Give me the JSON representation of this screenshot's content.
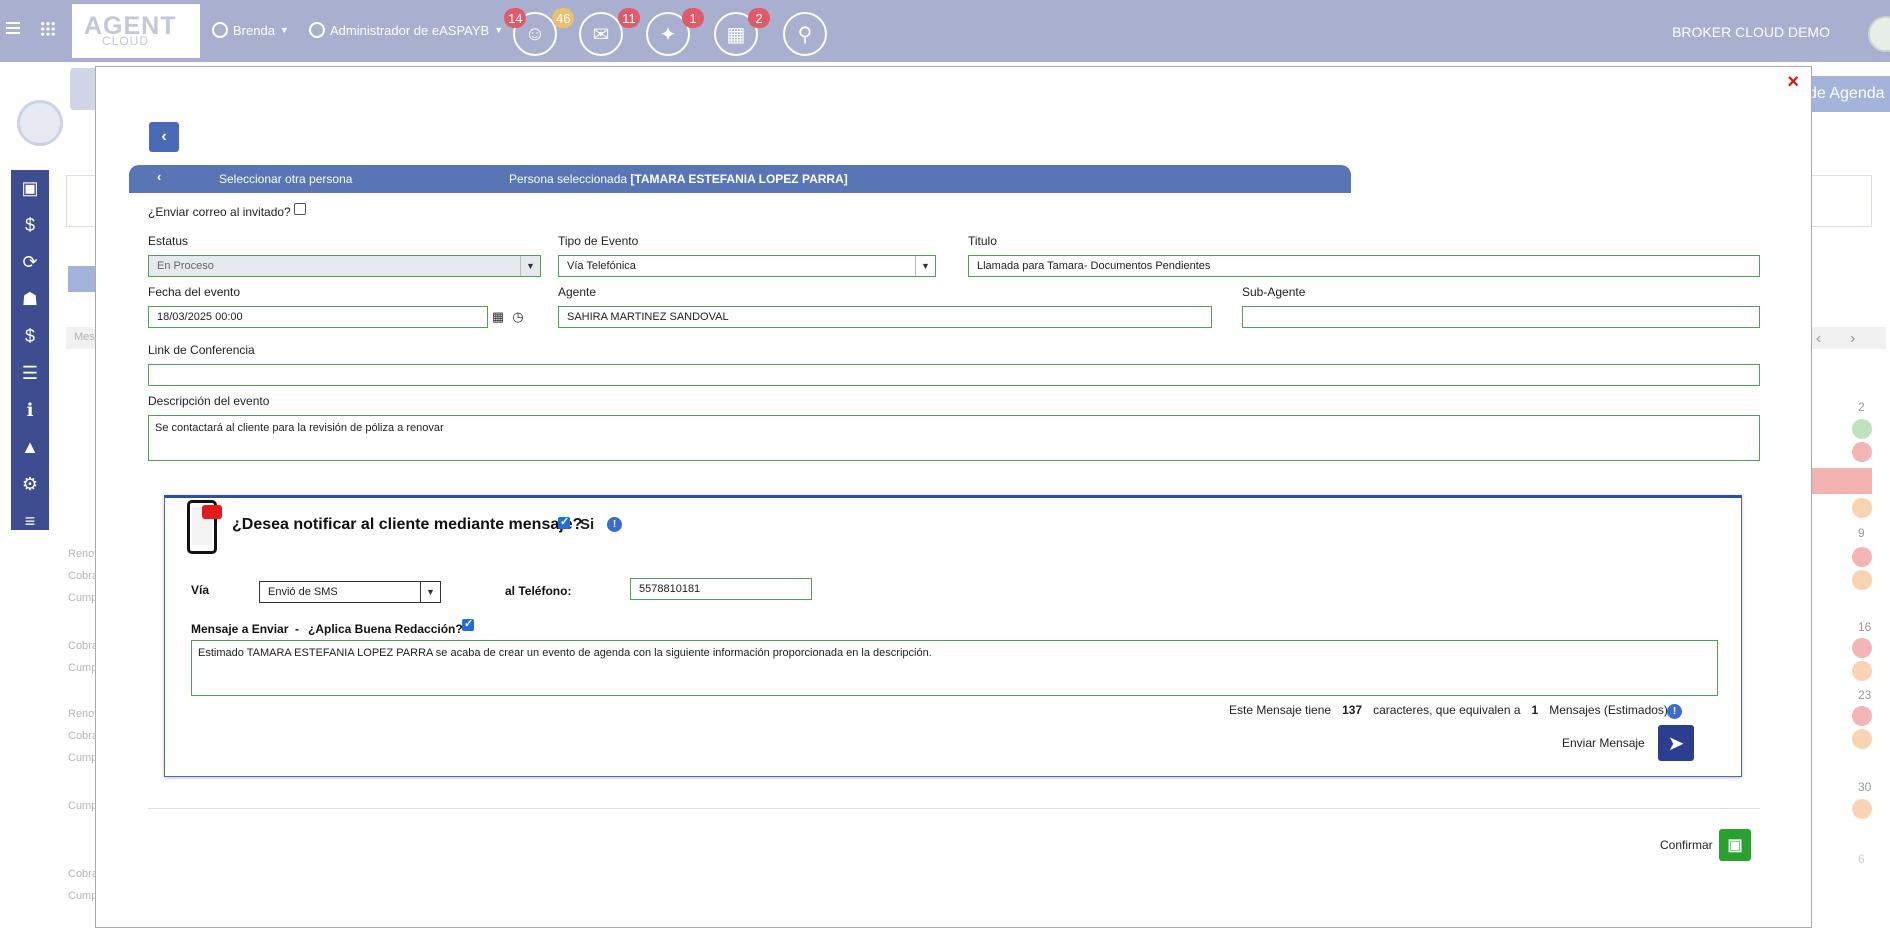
{
  "topbar": {
    "logo_main": "AGENT",
    "logo_sub": "CLOUD",
    "user": "Brenda",
    "role": "Administrador de eASPAYB",
    "badges": {
      "contacts": "14",
      "contacts2": "46",
      "mail": "11",
      "gifts": "1",
      "calendar": "2"
    },
    "company": "BROKER CLOUD DEMO"
  },
  "background": {
    "agenda_button": "de Agenda",
    "toolbar_text": "Mes",
    "labels": [
      "Renov",
      "Cobra",
      "Cump",
      "Cobra",
      "Cump",
      "Renov",
      "Cobra",
      "Cump",
      "Cump",
      "Cobra",
      "Cump"
    ],
    "day_numbers": [
      "2",
      "9",
      "16",
      "23",
      "30",
      "6"
    ]
  },
  "modal": {
    "close": "×",
    "back": "‹",
    "select_other": "Seleccionar otra persona",
    "selected_prefix": "Persona seleccionada",
    "selected_name": "[TAMARA ESTEFANIA LOPEZ PARRA]",
    "send_mail_label": "¿Enviar correo al invitado?",
    "status": {
      "label": "Estatus",
      "value": "En Proceso"
    },
    "event_type": {
      "label": "Tipo de Evento",
      "value": "Vía Telefónica"
    },
    "title": {
      "label": "Titulo",
      "value": "Llamada para Tamara- Documentos Pendientes"
    },
    "date": {
      "label": "Fecha del evento",
      "value": "18/03/2025 00:00"
    },
    "agent": {
      "label": "Agente",
      "value": "SAHIRA MARTINEZ SANDOVAL"
    },
    "sub_agent": {
      "label": "Sub-Agente",
      "value": ""
    },
    "conference": {
      "label": "Link de Conferencia",
      "value": ""
    },
    "description": {
      "label": "Descripción del evento",
      "value": "Se contactará al cliente para la revisión de póliza a renovar"
    },
    "notify": {
      "question": "¿Desea notificar al cliente mediante mensaje?",
      "yes": "Si",
      "via_label": "Vía",
      "via_value": "Envió de SMS",
      "phone_label": "al Teléfono:",
      "phone_value": "5578810181",
      "message_label": "Mensaje a Enviar",
      "dash": "-",
      "grammar_label": "¿Aplica Buena Redacción?",
      "message": "Estimado TAMARA ESTEFANIA LOPEZ PARRA se acaba de crear un evento de agenda con la siguiente información proporcionada en la descripción.",
      "count_prefix": "Este Mensaje tiene",
      "count_chars": "137",
      "count_middle": "caracteres, que equivalen a",
      "count_msgs": "1",
      "count_suffix": "Mensajes (Estimados)",
      "send_label": "Enviar Mensaje"
    },
    "confirm_label": "Confirmar"
  },
  "colors": {
    "topbar": "#a9b0cf",
    "primary": "#4a6ab8",
    "sidebar": "#3d4d90",
    "confirm": "#2aa12f",
    "close": "#e01010"
  }
}
